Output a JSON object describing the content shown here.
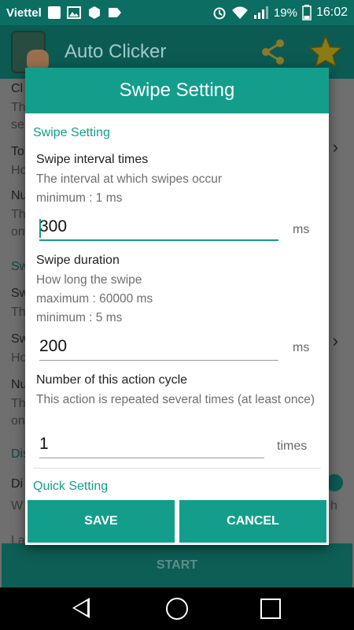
{
  "status_bar": {
    "carrier": "Viettel",
    "battery_percent": "19%",
    "time": "16:02",
    "icons": [
      "notification-icon",
      "image-icon",
      "hexagon-icon",
      "label-icon",
      "alarm-icon",
      "wifi-icon",
      "signal-icon",
      "battery-icon"
    ]
  },
  "app_bar": {
    "title": "Auto Clicker",
    "icons": [
      "app-logo-icon",
      "share-icon",
      "star-icon"
    ]
  },
  "background": {
    "fragments": [
      "Cl",
      "Th",
      "se",
      "To",
      "Ho",
      "Nu",
      "Th",
      "on",
      "Sw",
      "Sw",
      "Th",
      "Sw",
      "Ho",
      "Nu",
      "Th",
      "on",
      "Dis",
      "Di",
      "W",
      "h",
      "La"
    ],
    "start_label": "START"
  },
  "dialog": {
    "title": "Swipe Setting",
    "section_swipe": "Swipe Setting",
    "interval": {
      "title": "Swipe interval times",
      "desc": "The interval at which swipes occur",
      "min": "minimum : 1  ms",
      "value": "300",
      "unit": "ms"
    },
    "duration": {
      "title": "Swipe duration",
      "desc": "How long the swipe",
      "max": "maximum : 60000  ms",
      "min": "minimum : 5  ms",
      "value": "200",
      "unit": "ms"
    },
    "cycle": {
      "title": "Number of this action cycle",
      "desc": "This action is repeated several times (at least once)",
      "value": "1",
      "unit": "times"
    },
    "section_quick": "Quick Setting",
    "save_label": "SAVE",
    "cancel_label": "CANCEL"
  },
  "nav_bar": {
    "icons": [
      "back-icon",
      "home-icon",
      "recent-apps-icon"
    ]
  },
  "colors": {
    "accent": "#139e8c",
    "status_bar": "#0c6d63"
  }
}
